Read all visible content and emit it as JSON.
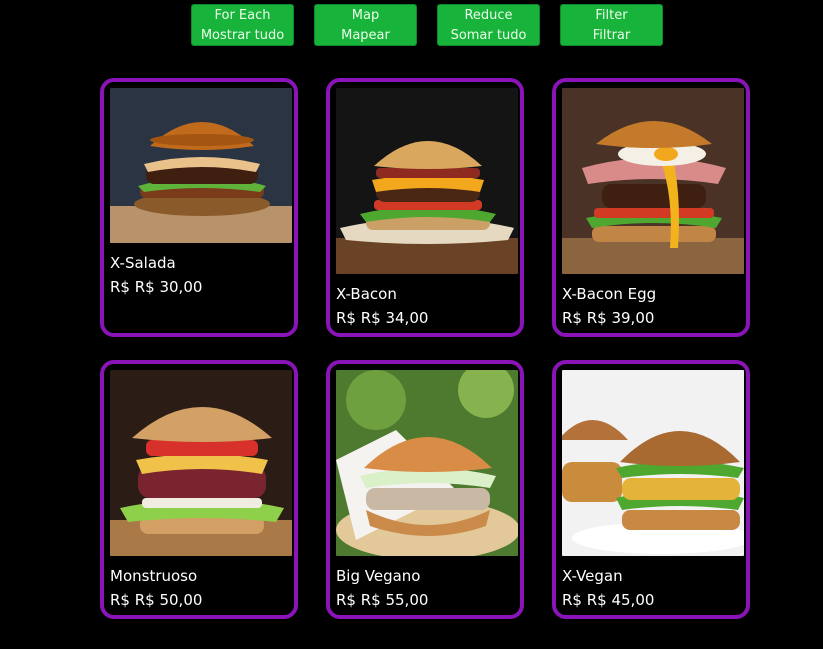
{
  "buttons": [
    {
      "line1": "For Each",
      "line2": "Mostrar tudo"
    },
    {
      "line1": "Map",
      "line2": "Mapear"
    },
    {
      "line1": "Reduce",
      "line2": "Somar tudo"
    },
    {
      "line1": "Filter",
      "line2": "Filtrar"
    }
  ],
  "products": [
    {
      "name": "X-Salada",
      "price": "R$ R$ 30,00"
    },
    {
      "name": "X-Bacon",
      "price": "R$ R$ 34,00"
    },
    {
      "name": "X-Bacon Egg",
      "price": "R$ R$ 39,00"
    },
    {
      "name": "Monstruoso",
      "price": "R$ R$ 50,00"
    },
    {
      "name": "Big Vegano",
      "price": "R$ R$ 55,00"
    },
    {
      "name": "X-Vegan",
      "price": "R$ R$ 45,00"
    }
  ],
  "colors": {
    "button_bg": "#18b33a",
    "card_border": "#8a14b8",
    "background": "#000000"
  }
}
